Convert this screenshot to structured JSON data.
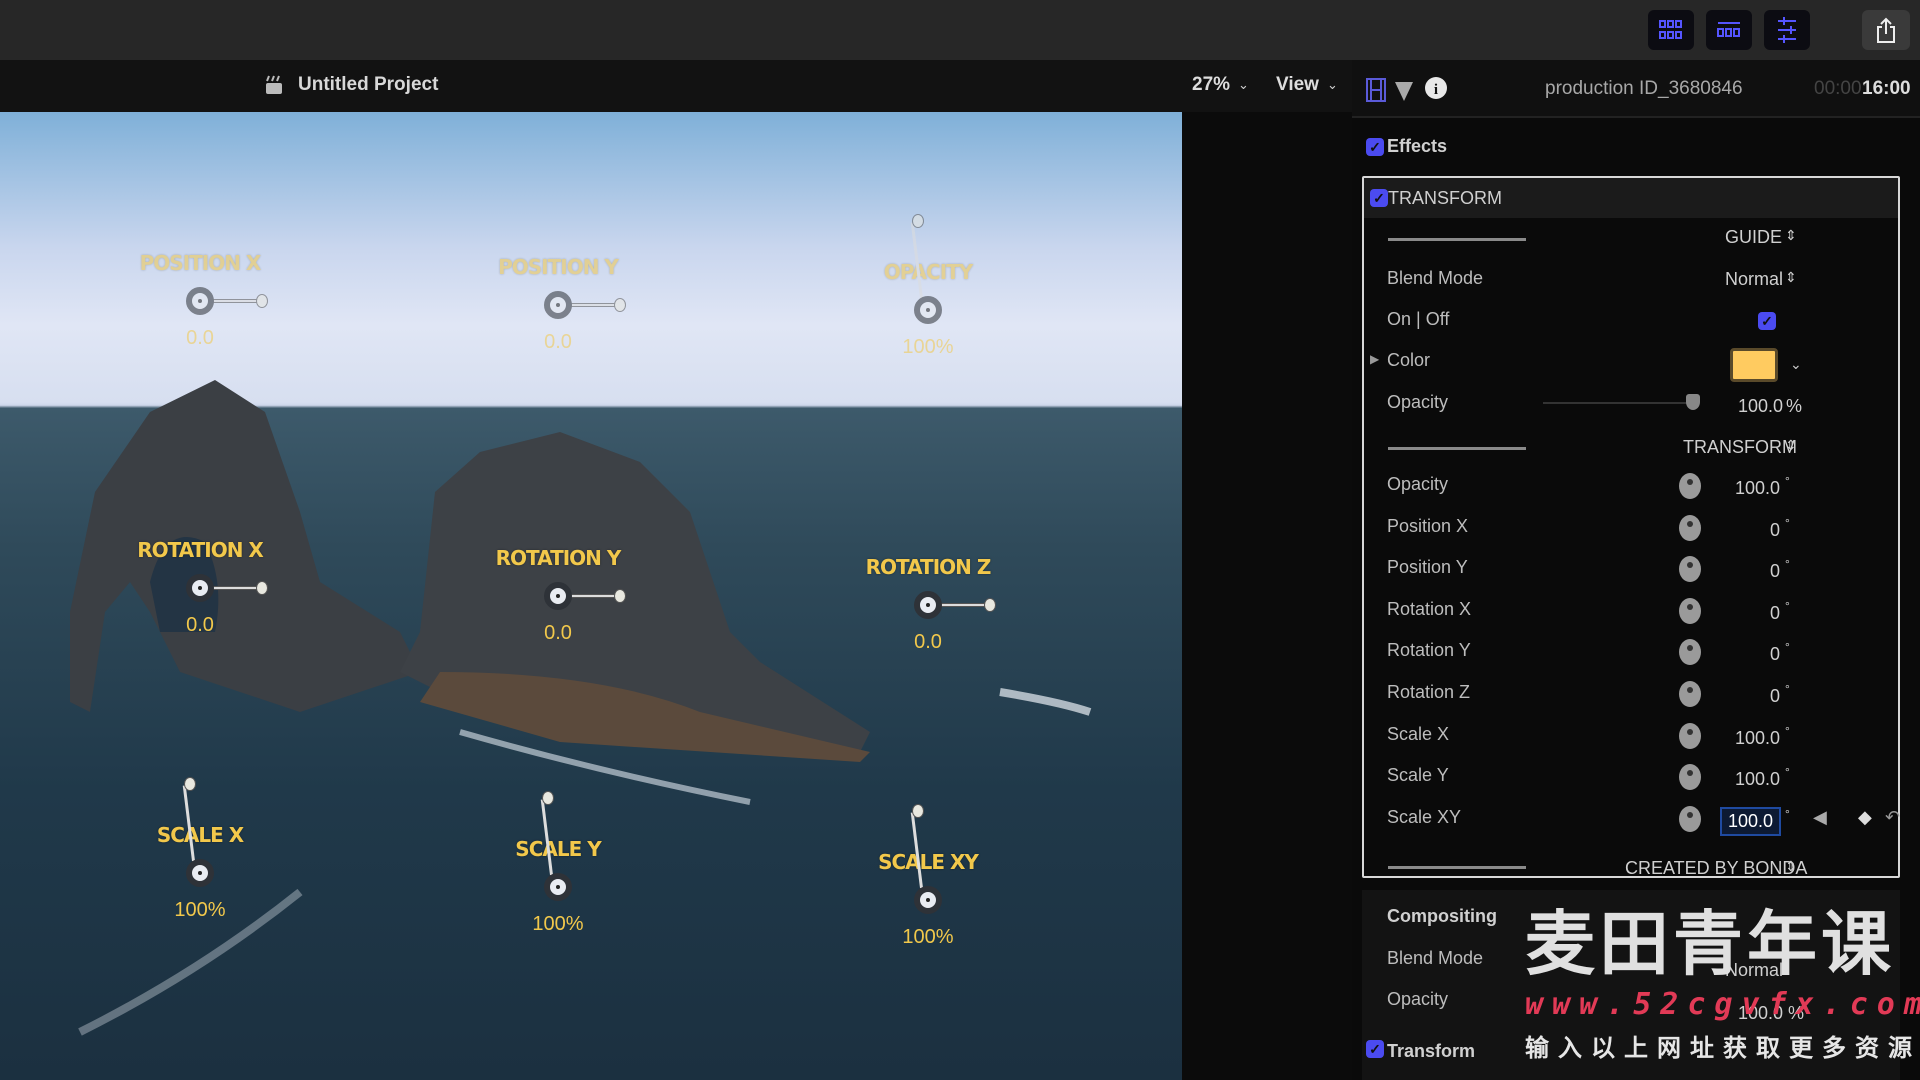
{
  "toolbar": {
    "icons": [
      "browser-grid-icon",
      "timeline-icon",
      "inspector-sliders-icon",
      "share-icon"
    ],
    "accent": "#4b4bf0"
  },
  "viewer": {
    "project_title": "Untitled Project",
    "zoom": "27%",
    "view_label": "View"
  },
  "inspector": {
    "clip_name": "production ID_3680846",
    "timecode_dim": "00:00:",
    "timecode": "16:00",
    "effects_label": "Effects",
    "transform_section": "TRANSFORM",
    "guide_select": "GUIDE",
    "blend_mode_label": "Blend Mode",
    "blend_mode_value": "Normal",
    "onoff_label": "On | Off",
    "color_label": "Color",
    "color_value": "#ffcb60",
    "opacity_label": "Opacity",
    "opacity_value": "100.0",
    "opacity_unit": "%",
    "transform_select": "TRANSFORM",
    "params": [
      {
        "label": "Opacity",
        "value": "100.0"
      },
      {
        "label": "Position X",
        "value": "0"
      },
      {
        "label": "Position Y",
        "value": "0"
      },
      {
        "label": "Rotation X",
        "value": "0"
      },
      {
        "label": "Rotation Y",
        "value": "0"
      },
      {
        "label": "Rotation Z",
        "value": "0"
      },
      {
        "label": "Scale X",
        "value": "100.0"
      },
      {
        "label": "Scale Y",
        "value": "100.0"
      },
      {
        "label": "Scale XY",
        "value": "100.0"
      }
    ],
    "param_unit": "°",
    "created_by": "CREATED BY BONDA",
    "compositing_label": "Compositing",
    "comp_blend_label": "Blend Mode",
    "comp_blend_value": "Normal",
    "comp_opacity_label": "Opacity",
    "comp_opacity_value": "100.0 %",
    "transform_label": "Transform"
  },
  "overlays": [
    {
      "label": "POSITION X",
      "value": "0.0",
      "handle": "right",
      "faded": true
    },
    {
      "label": "POSITION Y",
      "value": "0.0",
      "handle": "right",
      "faded": true
    },
    {
      "label": "OPACITY",
      "value": "100%",
      "handle": "up",
      "faded": true
    },
    {
      "label": "ROTATION X",
      "value": "0.0",
      "handle": "right",
      "faded": false
    },
    {
      "label": "ROTATION Y",
      "value": "0.0",
      "handle": "right",
      "faded": false
    },
    {
      "label": "ROTATION Z",
      "value": "0.0",
      "handle": "right",
      "faded": false
    },
    {
      "label": "SCALE X",
      "value": "100%",
      "handle": "up",
      "faded": false
    },
    {
      "label": "SCALE Y",
      "value": "100%",
      "handle": "up",
      "faded": false
    },
    {
      "label": "SCALE XY",
      "value": "100%",
      "handle": "up",
      "faded": false
    }
  ],
  "watermark": {
    "title": "麦田青年课",
    "url": "www.52cgvfx.com",
    "subtitle": "输入以上网址获取更多资源"
  }
}
